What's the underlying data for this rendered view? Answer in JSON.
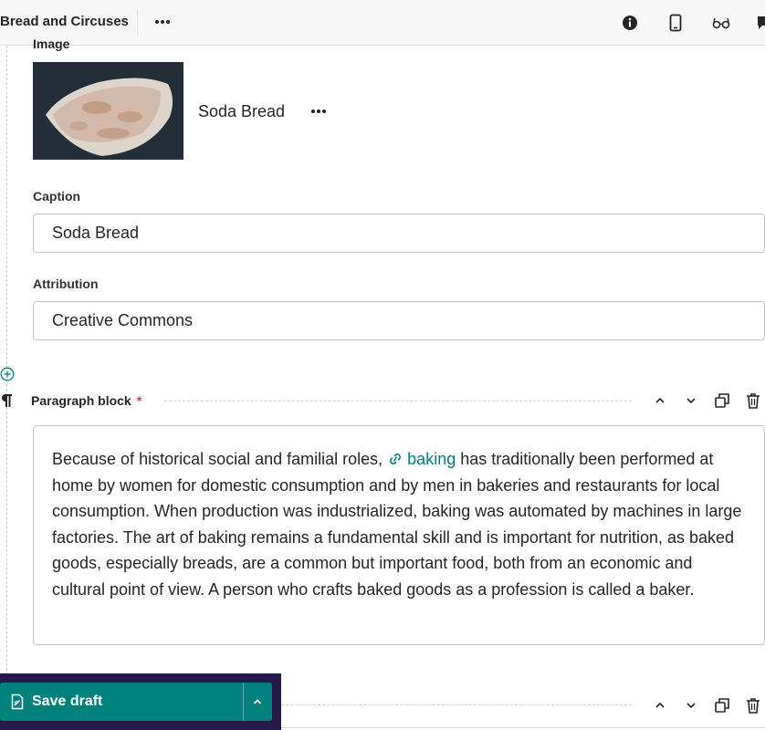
{
  "header": {
    "site_title": "Bread and Circuses",
    "icons": [
      "more-icon",
      "info-icon",
      "mobile-preview-icon",
      "glasses-preview-icon",
      "comments-icon"
    ]
  },
  "image_block": {
    "label": "Image",
    "image_title": "Soda Bread",
    "caption_label": "Caption",
    "caption_value": "Soda Bread",
    "attribution_label": "Attribution",
    "attribution_value": "Creative Commons"
  },
  "paragraph_block": {
    "title": "Paragraph block",
    "required_marker": "*",
    "text_before": "Because of historical social and familial roles, ",
    "link_text": "baking",
    "text_after": " has traditionally been performed at home by women for domestic consumption and by men in bakeries and restaurants for local consumption. When production was industrialized, baking was automated by machines in large factories. The art of baking remains a fundamental skill and is important for nutrition, as baked goods, especially breads, are a common but important food, both from an economic and cultural point of view. A person who crafts baked goods as a profession is called a baker."
  },
  "footer": {
    "save_label": "Save draft"
  },
  "colors": {
    "accent": "#007d7e",
    "save_bar_bg": "#261a4b",
    "save_button": "#00827c",
    "required": "#cd4444"
  }
}
